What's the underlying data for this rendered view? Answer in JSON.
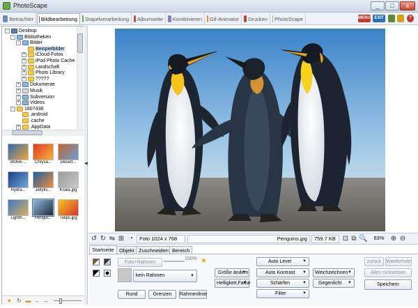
{
  "window": {
    "title": "PhotoScape",
    "min": "_",
    "max": "□",
    "close": "x"
  },
  "tabs": [
    {
      "label": "Betrachter",
      "color": "#6d8fb3"
    },
    {
      "label": "Bildbearbeitung",
      "color": "#3b6fb6"
    },
    {
      "label": "Stapelverarbeitung",
      "color": "#6aa84f"
    },
    {
      "label": "Albumseite",
      "color": "#c0504d"
    },
    {
      "label": "Kombinieren",
      "color": "#8e7cc3"
    },
    {
      "label": "Gif-Animator",
      "color": "#e69138"
    },
    {
      "label": "Drucken",
      "color": "#cc4125"
    },
    {
      "label": "PhotoScape",
      "color": "#93c47d"
    }
  ],
  "header_icons": {
    "menu": "MENU",
    "exit": "EXIT"
  },
  "tree": [
    {
      "label": "Desktop",
      "icon": "desk",
      "ex": "-"
    },
    {
      "label": "Bibliotheken",
      "icon": "blue",
      "ex": "-"
    },
    {
      "label": "Bilder",
      "icon": "blue",
      "ex": "-"
    },
    {
      "label": "Beispielbilder",
      "icon": "fold",
      "ex": "",
      "selected": true
    },
    {
      "label": "iCloud-Fotos",
      "icon": "fold",
      "ex": "+"
    },
    {
      "label": "iPod Photo Cache",
      "icon": "fold",
      "ex": "+"
    },
    {
      "label": "Landschaft",
      "icon": "fold",
      "ex": "+"
    },
    {
      "label": "Photo Library",
      "icon": "fold",
      "ex": "+"
    },
    {
      "label": "?????",
      "icon": "fold",
      "ex": "+"
    },
    {
      "label": "Dokumente",
      "icon": "blue",
      "ex": "+"
    },
    {
      "label": "Musik",
      "icon": "music",
      "ex": "+"
    },
    {
      "label": "Subversion",
      "icon": "blue",
      "ex": "+"
    },
    {
      "label": "Videos",
      "icon": "blue",
      "ex": "+"
    },
    {
      "label": "1607436",
      "icon": "fold",
      "ex": "-"
    },
    {
      "label": ".android",
      "icon": "fold",
      "ex": ""
    },
    {
      "label": ".cache",
      "icon": "fold",
      "ex": ""
    },
    {
      "label": ".AppData",
      "icon": "fold",
      "ex": "+"
    }
  ],
  "thumbnails": [
    {
      "caption": "38356-...",
      "c1": "#2d6cb3",
      "c2": "#f2a33a"
    },
    {
      "caption": "Chrysa...",
      "c1": "#e03a1e",
      "c2": "#f7b23b"
    },
    {
      "caption": "Desert...",
      "c1": "#c0652a",
      "c2": "#6aa0d8"
    },
    {
      "caption": "Hydra...",
      "c1": "#1d3d8a",
      "c2": "#6fa8dc"
    },
    {
      "caption": "Jellyfis...",
      "c1": "#1a5fa3",
      "c2": "#f08d3c"
    },
    {
      "caption": "Koala.jpg",
      "c1": "#9a9a9a",
      "c2": "#c9c9c9"
    },
    {
      "caption": "Lighth...",
      "c1": "#3f77c3",
      "c2": "#d7b066"
    },
    {
      "caption": "Pengui...",
      "c1": "#8fb6de",
      "c2": "#1f2b3a"
    },
    {
      "caption": "Tulips.jpg",
      "c1": "#f5c51f",
      "c2": "#d9342b"
    }
  ],
  "status": {
    "photo_size": "Foto 1024 x 768",
    "filename": "Penguins.jpg",
    "filesize": "759.7 KB",
    "zoom": "63%"
  },
  "edit_tabs": [
    "Startseite",
    "Objekt",
    "Zuschneiden",
    "Bereich"
  ],
  "editor": {
    "foto_rahmen": "Foto+Rahmen",
    "opacity": "100%",
    "frame": "kein Rahmen",
    "rund": "Rund",
    "grenzen": "Grenzen",
    "rahmenlinie": "Rahmenlinie",
    "groesse": "Größe ändern",
    "helligkeit": "Helligkeit,Farbe",
    "auto_level": "Auto Level",
    "auto_kontrast": "Auto Kontrast",
    "schaerfen": "Schärfen",
    "filter": "Filter",
    "weichzeichnen": "Weichzeichnen",
    "gegenlicht": "Gegenlicht",
    "zurueck": "zurück",
    "wiederholen": "Wiederholen",
    "alles_ruecksetzen": "Alles rücksetzen",
    "speichern": "Speichern"
  }
}
